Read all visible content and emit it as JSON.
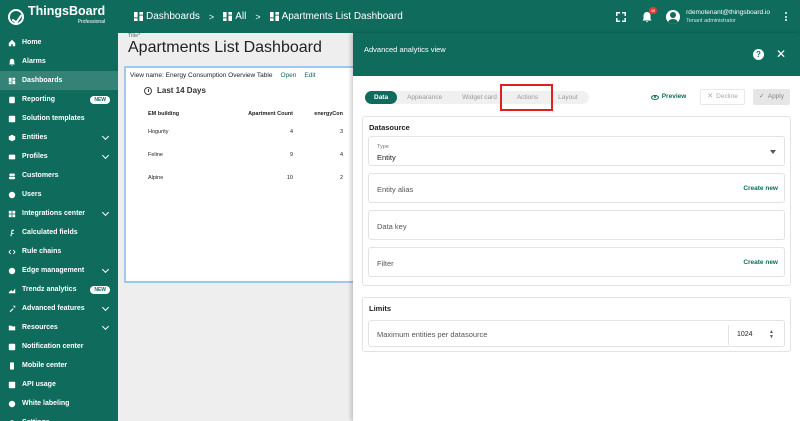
{
  "app": {
    "brand": "ThingsBoard",
    "edition": "Professional"
  },
  "sidebar": {
    "items": [
      {
        "label": "Home",
        "icon": "home-icon",
        "active": false
      },
      {
        "label": "Alarms",
        "icon": "bell-icon",
        "active": false
      },
      {
        "label": "Dashboards",
        "icon": "dashboard-icon",
        "active": true
      },
      {
        "label": "Reporting",
        "icon": "report-icon",
        "badge": "NEW"
      },
      {
        "label": "Solution templates",
        "icon": "template-icon"
      },
      {
        "label": "Entities",
        "icon": "entities-icon",
        "expandable": true
      },
      {
        "label": "Profiles",
        "icon": "profiles-icon",
        "expandable": true
      },
      {
        "label": "Customers",
        "icon": "customers-icon"
      },
      {
        "label": "Users",
        "icon": "user-icon"
      },
      {
        "label": "Integrations center",
        "icon": "integrations-icon",
        "expandable": true
      },
      {
        "label": "Calculated fields",
        "icon": "function-icon"
      },
      {
        "label": "Rule chains",
        "icon": "code-icon"
      },
      {
        "label": "Edge management",
        "icon": "edge-icon",
        "expandable": true
      },
      {
        "label": "Trendz analytics",
        "icon": "trendz-icon",
        "badge": "NEW"
      },
      {
        "label": "Advanced features",
        "icon": "tools-icon",
        "expandable": true
      },
      {
        "label": "Resources",
        "icon": "folder-icon",
        "expandable": true
      },
      {
        "label": "Notification center",
        "icon": "notification-icon"
      },
      {
        "label": "Mobile center",
        "icon": "mobile-icon"
      },
      {
        "label": "API usage",
        "icon": "api-icon"
      },
      {
        "label": "White labeling",
        "icon": "palette-icon"
      },
      {
        "label": "Settings",
        "icon": "settings-icon"
      }
    ]
  },
  "topbar": {
    "crumbs": [
      "Dashboards",
      "All",
      "Apartments List Dashboard"
    ],
    "separator": ">",
    "notifications": "40",
    "user_email": "rdemotenant@thingsboard.io",
    "user_role": "Tenant administrator"
  },
  "dashboard": {
    "title_label": "Title*",
    "title": "Apartments List Dashboard",
    "widget": {
      "view_name": "View name: Energy Consumption Overview Table",
      "open": "Open",
      "edit": "Edit",
      "timewindow": "Last 14 Days",
      "columns": [
        "EM building",
        "Apartment Count",
        "energyCon"
      ],
      "rows": [
        [
          "Hogurity",
          "4",
          "3"
        ],
        [
          "Feline",
          "9",
          "4"
        ],
        [
          "Alpine",
          "10",
          "2"
        ]
      ]
    }
  },
  "panel": {
    "title": "Advanced analytics view",
    "help": "?",
    "close": "✕",
    "tabs": [
      "Data",
      "Appearance",
      "Widget card",
      "Actions",
      "Layout"
    ],
    "active_tab": "Data",
    "preview": "Preview",
    "decline": "Decline",
    "apply": "Apply",
    "datasource": {
      "title": "Datasource",
      "type_label": "Type",
      "type_value": "Entity",
      "entity_alias": "Entity alias",
      "create_new_alias": "Create new",
      "data_key": "Data key",
      "filter": "Filter",
      "create_new_filter": "Create new"
    },
    "limits": {
      "title": "Limits",
      "max_entities_label": "Maximum entities per datasource",
      "max_entities_value": "1024"
    }
  },
  "colors": {
    "primary": "#0f6b5c",
    "highlight": "#e02020",
    "widget_border": "#9fc7ef"
  }
}
